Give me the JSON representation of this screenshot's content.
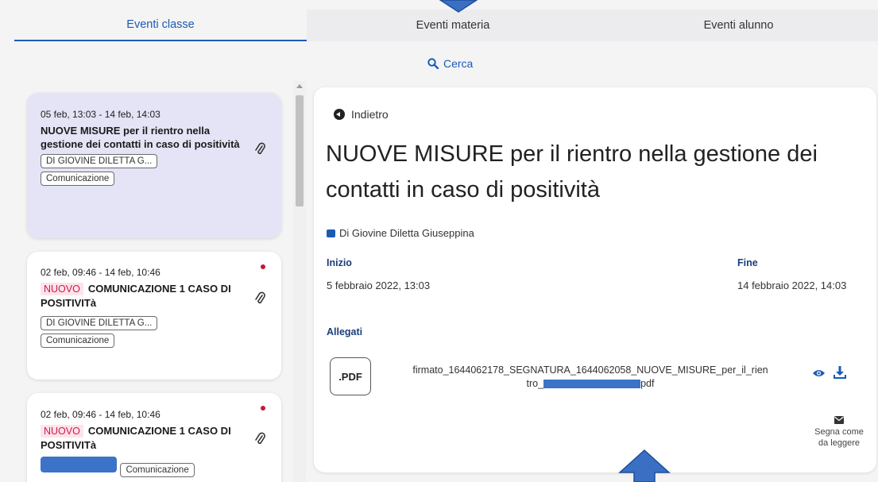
{
  "tabs": [
    {
      "label": "Eventi classe"
    },
    {
      "label": "Eventi materia"
    },
    {
      "label": "Eventi alunno"
    }
  ],
  "search": {
    "label": "Cerca",
    "icon": "search-icon"
  },
  "events": [
    {
      "date": "05 feb, 13:03 - 14 feb, 14:03",
      "title": "NUOVE MISURE per il rientro nella gestione dei contatti in caso di positività",
      "new_badge": "",
      "author_chip": "DI GIOVINE DILETTA G...",
      "type_chip": "Comunicazione",
      "selected": true
    },
    {
      "date": "02 feb, 09:46 - 14 feb, 10:46",
      "title": "COMUNICAZIONE 1 CASO DI POSITIVITà",
      "new_badge": "NUOVO",
      "author_chip": "DI GIOVINE DILETTA G...",
      "type_chip": "Comunicazione",
      "selected": false
    },
    {
      "date": "02 feb, 09:46 - 14 feb, 10:46",
      "title": "COMUNICAZIONE 1 CASO DI POSITIVITà",
      "new_badge": "NUOVO",
      "author_chip": "",
      "type_chip": "Comunicazione",
      "selected": false
    }
  ],
  "detail": {
    "back_label": "Indietro",
    "title": "NUOVE MISURE per il rientro nella gestione dei contatti in caso di positività",
    "author": "Di Giovine Diletta Giuseppina",
    "start_label": "Inizio",
    "start_value": "5 febbraio 2022, 13:03",
    "end_label": "Fine",
    "end_value": "14 febbraio 2022, 14:03",
    "attachments_label": "Allegati",
    "attachment": {
      "type": ".PDF",
      "name_line1": "firmato_1644062178_SEGNATURA_1644062058_NUOVE_MISURE_per_il_rien",
      "name_line2_start": "tro_",
      "name_line2_end": "pdf"
    },
    "mark_read_line1": "Segna come",
    "mark_read_line2": "da leggere"
  },
  "colors": {
    "accent": "#1a5bb5",
    "new_badge": "#d11a4a",
    "redaction": "#3b73c9",
    "arrow": "#3a6fc4"
  }
}
